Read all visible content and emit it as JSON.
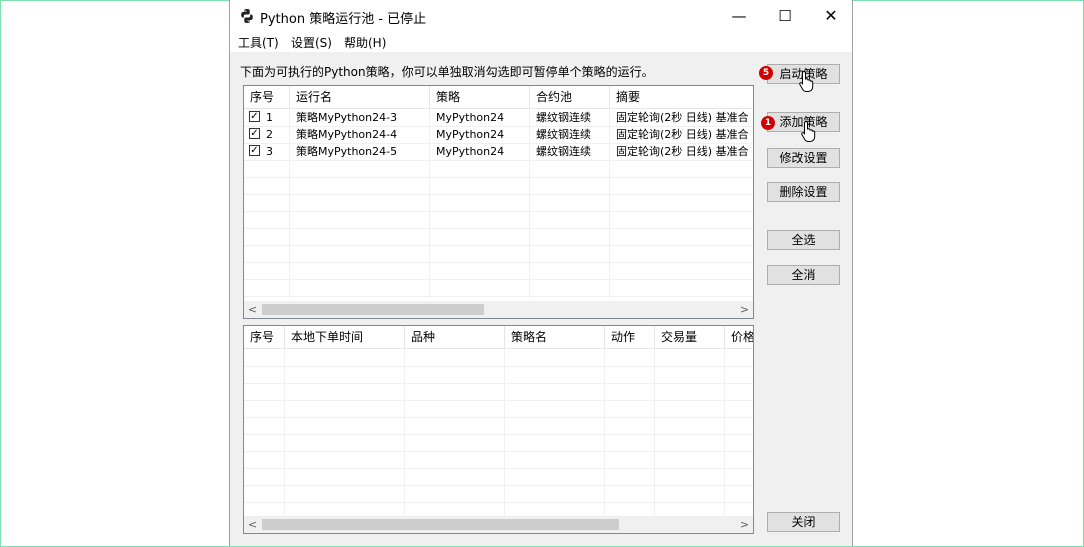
{
  "window": {
    "title": "Python 策略运行池 - 已停止",
    "minimize_glyph": "—",
    "maximize_glyph": "☐",
    "close_glyph": "✕"
  },
  "menu": [
    {
      "label": "工具(T)"
    },
    {
      "label": "设置(S)"
    },
    {
      "label": "帮助(H)"
    }
  ],
  "instruction": "下面为可执行的Python策略，你可以单独取消勾选即可暂停单个策略的运行。",
  "strategy_table": {
    "columns": [
      "序号",
      "运行名",
      "策略",
      "合约池",
      "摘要"
    ],
    "rows": [
      {
        "checked": true,
        "index": "1",
        "run_name": "策略MyPython24-3",
        "strategy": "MyPython24",
        "pool": "螺纹钢连续",
        "summary": "固定轮询(2秒 日线) 基准合"
      },
      {
        "checked": true,
        "index": "2",
        "run_name": "策略MyPython24-4",
        "strategy": "MyPython24",
        "pool": "螺纹钢连续",
        "summary": "固定轮询(2秒 日线) 基准合"
      },
      {
        "checked": true,
        "index": "3",
        "run_name": "策略MyPython24-5",
        "strategy": "MyPython24",
        "pool": "螺纹钢连续",
        "summary": "固定轮询(2秒 日线) 基准合"
      }
    ],
    "scroll_left": "<",
    "scroll_right": ">"
  },
  "order_table": {
    "columns": [
      "序号",
      "本地下单时间",
      "品种",
      "策略名",
      "动作",
      "交易量",
      "价格"
    ],
    "scroll_left": "<",
    "scroll_right": ">"
  },
  "buttons": {
    "start": "启动策略",
    "add": "添加策略",
    "modify": "修改设置",
    "delete": "删除设置",
    "select_all": "全选",
    "deselect_all": "全消",
    "close": "关闭"
  },
  "badges": {
    "start": "5",
    "add": "1"
  },
  "colors": {
    "frame": "#7ee0b0",
    "badge": "#d00000",
    "window_bg": "#f0f0f0"
  }
}
